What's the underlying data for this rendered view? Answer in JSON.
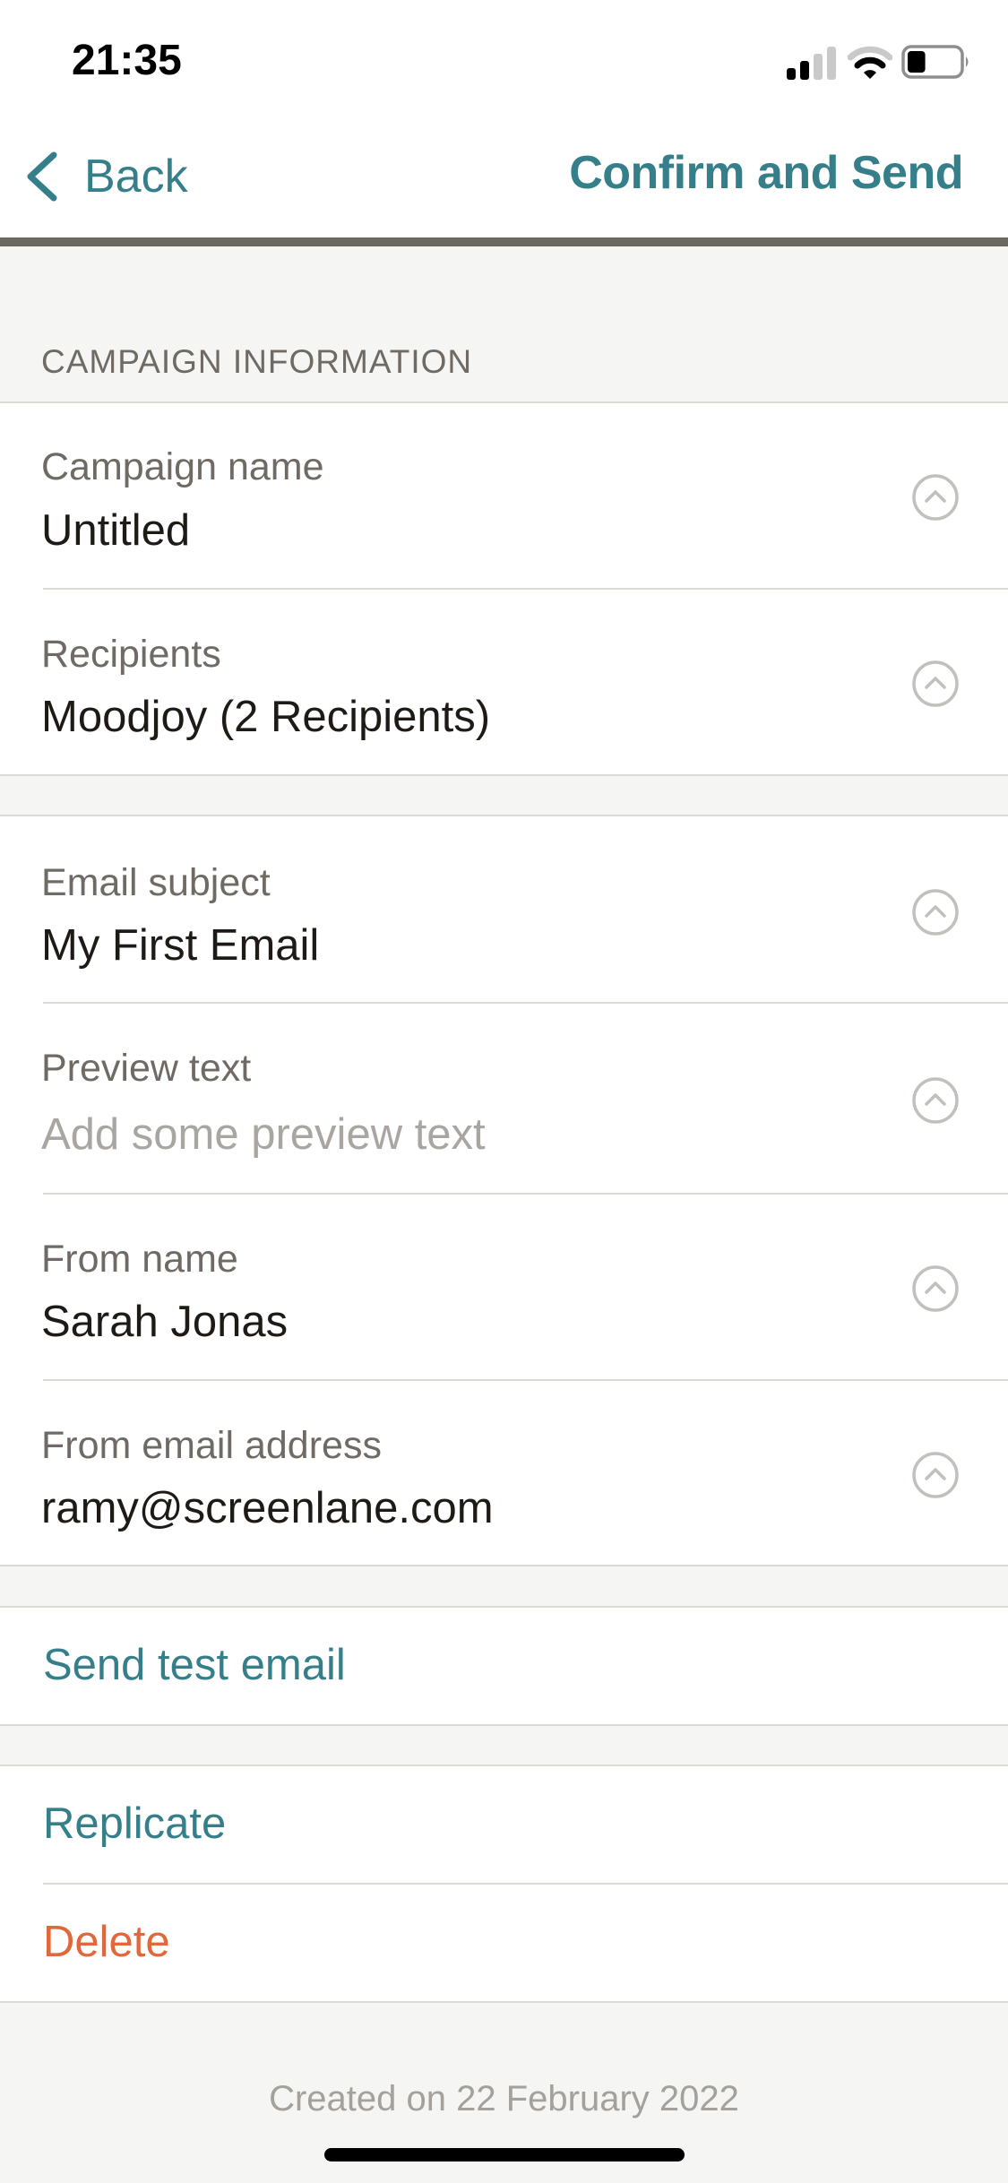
{
  "status_bar": {
    "time": "21:35",
    "signal_bars_active": 2,
    "signal_bars_total": 4,
    "wifi_arcs_active": 2,
    "wifi_arcs_total": 3,
    "battery_percent": 35
  },
  "nav": {
    "back_label": "Back",
    "title": "Confirm and Send",
    "back_icon": "chevron-left-icon"
  },
  "colors": {
    "accent": "#357f8a",
    "destructive": "#e0683a",
    "label": "#6f6a64",
    "value": "#1e1a16",
    "placeholder": "#a9a5a1",
    "background": "#f5f5f3",
    "nav_divider": "#6b6761"
  },
  "campaign_section": {
    "header": "CAMPAIGN INFORMATION",
    "fields": [
      {
        "label": "Campaign name",
        "value": "Untitled",
        "icon": "chevron-up-circle-icon"
      },
      {
        "label": "Recipients",
        "value": "Moodjoy (2 Recipients)",
        "icon": "chevron-up-circle-icon"
      }
    ]
  },
  "email_section": {
    "fields": [
      {
        "label": "Email subject",
        "value": "My First Email",
        "icon": "chevron-up-circle-icon"
      },
      {
        "label": "Preview text",
        "value": "",
        "placeholder": "Add some preview text",
        "icon": "chevron-up-circle-icon"
      },
      {
        "label": "From name",
        "value": "Sarah Jonas",
        "icon": "chevron-up-circle-icon"
      },
      {
        "label": "From email address",
        "value": "ramy@screenlane.com",
        "icon": "chevron-up-circle-icon"
      }
    ]
  },
  "actions": {
    "send_test": "Send test email",
    "replicate": "Replicate",
    "delete": "Delete"
  },
  "footer": {
    "created_on": "Created on 22 February 2022"
  }
}
